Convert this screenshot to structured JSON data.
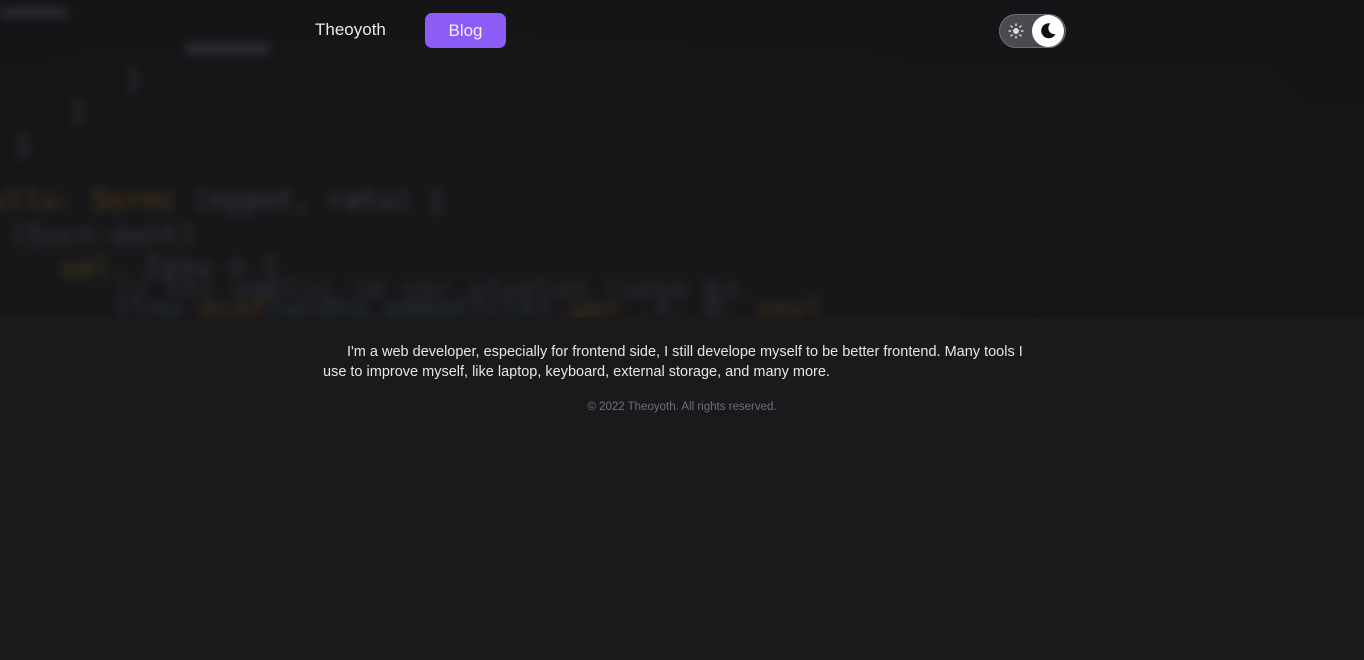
{
  "nav": {
    "brand": "Theoyoth",
    "blog_label": "Blog",
    "accent_color": "#8b5cf6"
  },
  "theme_toggle": {
    "left_icon": "sun-icon",
    "right_icon": "moon-icon",
    "mode": "dark"
  },
  "hero": {
    "background": "blurred-code-image"
  },
  "intro": {
    "text": "I'm a web developer, especially for frontend side, I still develope myself to be better frontend. Many tools I use to improve myself, like laptop, keyboard, external storage, and many more."
  },
  "footer": {
    "copyright": "© 2022 Theoyoth. All rights reserved."
  }
}
